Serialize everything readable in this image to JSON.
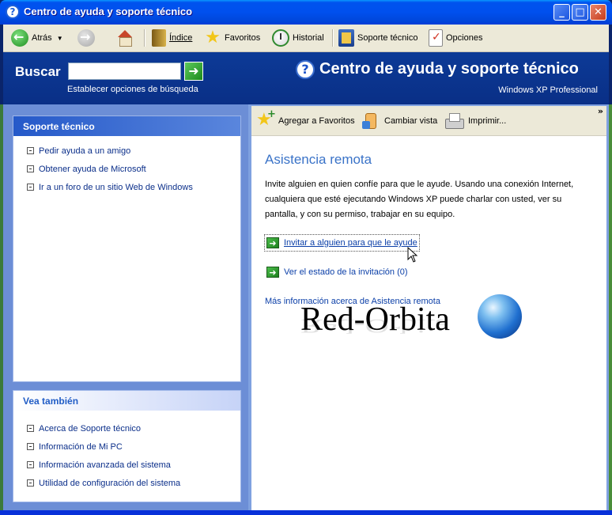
{
  "window": {
    "title": "Centro de ayuda y soporte técnico",
    "controls": {
      "minimize": "_",
      "maximize": "□",
      "close": "✕"
    }
  },
  "toolbar": {
    "back": "Atrás",
    "index": "Índice",
    "favorites": "Favoritos",
    "history": "Historial",
    "support": "Soporte técnico",
    "options": "Opciones"
  },
  "header": {
    "search_label": "Buscar",
    "search_value": "",
    "search_options": "Establecer opciones de búsqueda",
    "title": "Centro de ayuda y soporte técnico",
    "subtitle": "Windows XP Professional"
  },
  "left_panels": [
    {
      "title": "Soporte técnico",
      "links": [
        "Pedir ayuda a un amigo",
        "Obtener ayuda de Microsoft",
        "Ir a un foro de un sitio Web de Windows"
      ]
    },
    {
      "title": "Vea también",
      "links": [
        "Acerca de Soporte técnico",
        "Información de Mi PC",
        "Información avanzada del sistema",
        "Utilidad de configuración del sistema"
      ]
    }
  ],
  "content_toolbar": {
    "add_favorites": "Agregar a Favoritos",
    "change_view": "Cambiar vista",
    "print": "Imprimir...",
    "more": "»"
  },
  "main": {
    "title": "Asistencia remota",
    "body": "Invite alguien en quien confíe para que le ayude. Usando una conexión Internet, cualquiera que esté ejecutando Windows XP puede charlar con usted, ver su pantalla, y con su permiso, trabajar en su equipo.",
    "invite_link": "Invitar a alguien para que le ayude",
    "status_link": "Ver el estado de la invitación (0)",
    "more_info": "Más información acerca de Asistencia remota"
  },
  "watermark": {
    "text": "Red-Orbita"
  },
  "colors": {
    "titlebar": "#0053ee",
    "header": "#0c3a97",
    "link": "#0b2f8a",
    "accent_title": "#3a73c8"
  }
}
